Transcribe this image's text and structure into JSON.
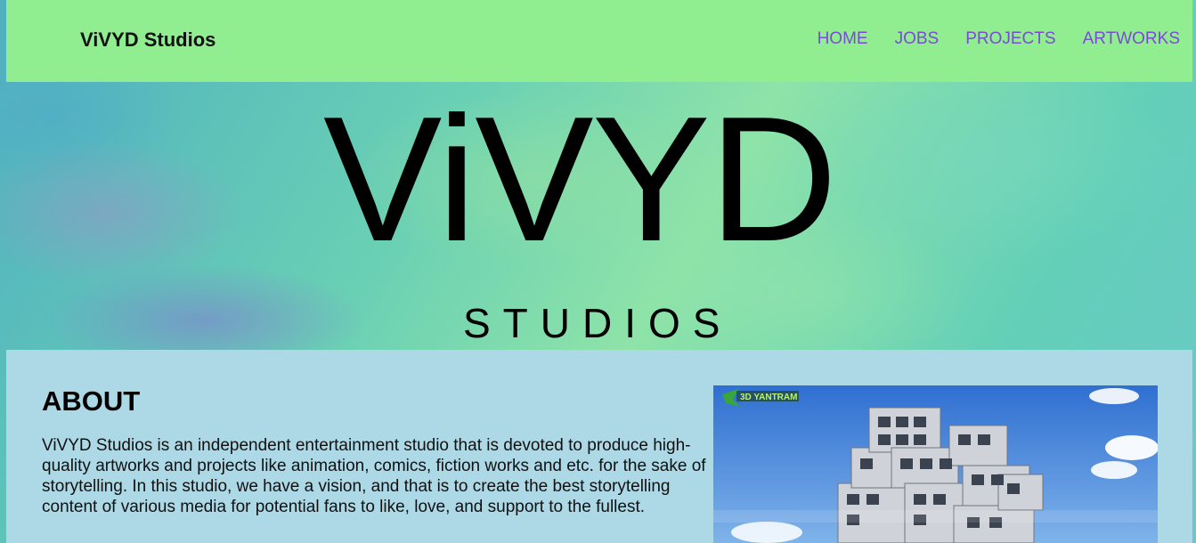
{
  "navbar": {
    "brand": "ViVYD Studios",
    "links": [
      "HOME",
      "JOBS",
      "PROJECTS",
      "ARTWORKS"
    ]
  },
  "hero": {
    "logo_text": "ViVYD",
    "sub_text": "STUDIOS"
  },
  "about": {
    "title": "ABOUT",
    "body": "ViVYD Studios is an independent entertainment studio that is devoted to produce high-quality artworks and projects like animation, comics, fiction works and etc. for the sake of storytelling. In this studio, we have a vision, and that is to create the best storytelling content of various media for potential fans to like, love, and support to the fullest.",
    "image_logo_text": "3D YANTRAM"
  },
  "colors": {
    "navbar_bg": "#90ee90",
    "nav_link": "#7b4bd6",
    "about_bg": "#add8e6"
  }
}
